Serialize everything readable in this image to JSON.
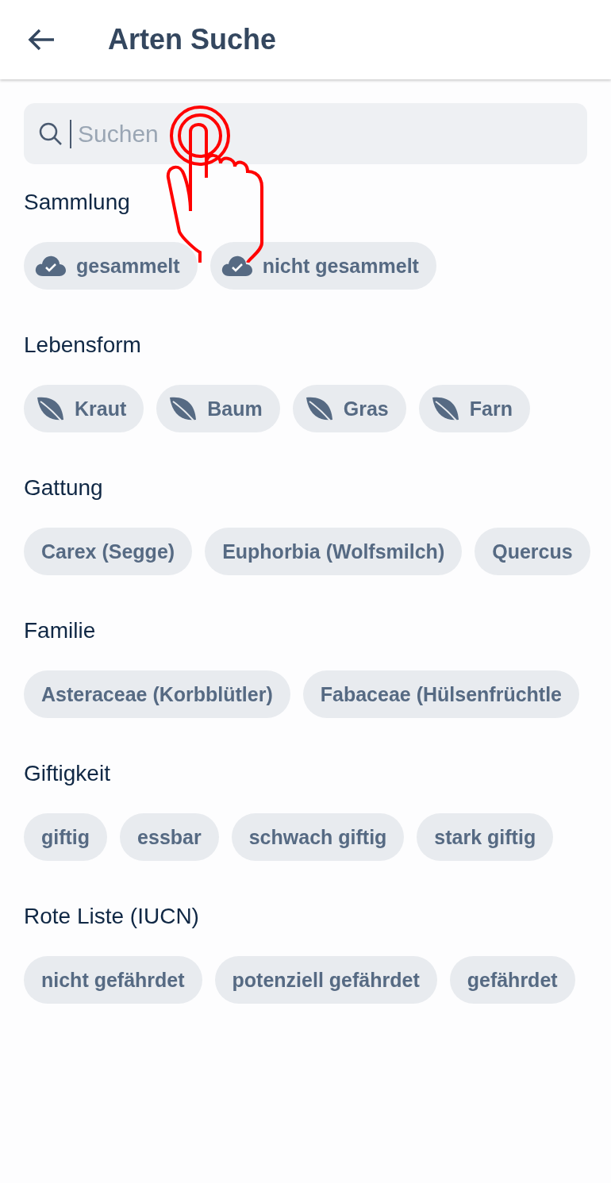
{
  "header": {
    "title": "Arten Suche"
  },
  "search": {
    "placeholder": "Suchen",
    "focused": true
  },
  "sections": [
    {
      "title": "Sammlung",
      "chips": [
        {
          "label": "gesammelt",
          "kind": "cloud"
        },
        {
          "label": "nicht gesammelt",
          "kind": "cloud"
        }
      ]
    },
    {
      "title": "Lebensform",
      "chips": [
        {
          "label": "Kraut",
          "kind": "leaf"
        },
        {
          "label": "Baum",
          "kind": "leaf"
        },
        {
          "label": "Gras",
          "kind": "leaf"
        },
        {
          "label": "Farn",
          "kind": "leaf"
        }
      ]
    },
    {
      "title": "Gattung",
      "chips": [
        {
          "label": "Carex (Segge)",
          "kind": "plain"
        },
        {
          "label": "Euphorbia (Wolfsmilch)",
          "kind": "plain"
        },
        {
          "label": "Quercus",
          "kind": "plain"
        }
      ]
    },
    {
      "title": "Familie",
      "chips": [
        {
          "label": "Asteraceae (Korbblütler)",
          "kind": "plain"
        },
        {
          "label": "Fabaceae (Hülsenfrüchtle",
          "kind": "plain"
        }
      ]
    },
    {
      "title": "Giftigkeit",
      "chips": [
        {
          "label": "giftig",
          "kind": "plain"
        },
        {
          "label": "essbar",
          "kind": "plain"
        },
        {
          "label": "schwach giftig",
          "kind": "plain"
        },
        {
          "label": "stark giftig",
          "kind": "plain"
        }
      ]
    },
    {
      "title": "Rote Liste (IUCN)",
      "chips": [
        {
          "label": "nicht gefährdet",
          "kind": "plain"
        },
        {
          "label": "potenziell gefährdet",
          "kind": "plain"
        },
        {
          "label": "gefährdet",
          "kind": "plain"
        }
      ]
    }
  ]
}
